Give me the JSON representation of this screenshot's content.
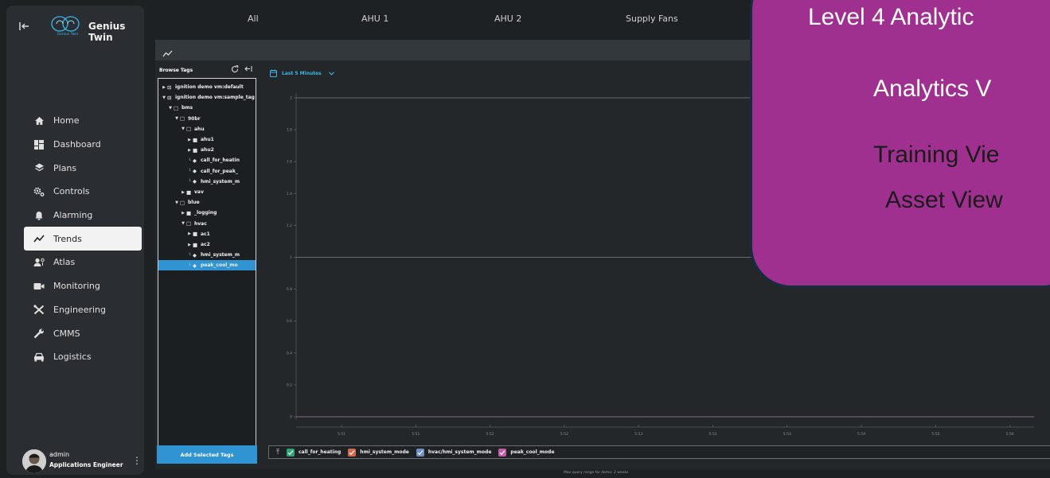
{
  "app": {
    "brand": "Genius Twin",
    "logo_caption": "Genius Twin"
  },
  "sidebar": {
    "items": [
      {
        "label": "Home",
        "icon": "home-icon",
        "active": false
      },
      {
        "label": "Dashboard",
        "icon": "dashboard-icon",
        "active": false
      },
      {
        "label": "Plans",
        "icon": "layers-icon",
        "active": false
      },
      {
        "label": "Controls",
        "icon": "gears-icon",
        "active": false
      },
      {
        "label": "Alarming",
        "icon": "bell-icon",
        "active": false
      },
      {
        "label": "Trends",
        "icon": "trend-line-icon",
        "active": true
      },
      {
        "label": "Atlas",
        "icon": "user-group-icon",
        "active": false
      },
      {
        "label": "Monitoring",
        "icon": "video-camera-icon",
        "active": false
      },
      {
        "label": "Engineering",
        "icon": "tools-icon",
        "active": false
      },
      {
        "label": "CMMS",
        "icon": "wrench-icon",
        "active": false
      },
      {
        "label": "Logistics",
        "icon": "car-icon",
        "active": false
      }
    ],
    "user": {
      "name": "admin",
      "role": "Applications Engineer"
    }
  },
  "tabs": [
    "All",
    "AHU 1",
    "AHU 2",
    "Supply Fans"
  ],
  "browse": {
    "title": "Browse Tags",
    "add_button": "Add Selected Tags",
    "tree": [
      {
        "label": "ignition demo vm:default",
        "depth": 0,
        "expanded": false,
        "type": "provider"
      },
      {
        "label": "ignition demo vm:sample_tag",
        "depth": 0,
        "expanded": true,
        "type": "provider"
      },
      {
        "label": "bms",
        "depth": 1,
        "expanded": true,
        "type": "folder"
      },
      {
        "label": "90br",
        "depth": 2,
        "expanded": true,
        "type": "folder"
      },
      {
        "label": "ahu",
        "depth": 3,
        "expanded": true,
        "type": "folder"
      },
      {
        "label": "ahu1",
        "depth": 4,
        "expanded": false,
        "type": "folder-filled"
      },
      {
        "label": "ahu2",
        "depth": 4,
        "expanded": false,
        "type": "folder-filled"
      },
      {
        "label": "call_for_heatin",
        "depth": 4,
        "type": "tag"
      },
      {
        "label": "call_for_peak_",
        "depth": 4,
        "type": "tag"
      },
      {
        "label": "hmi_system_m",
        "depth": 4,
        "type": "tag"
      },
      {
        "label": "vav",
        "depth": 3,
        "expanded": false,
        "type": "folder-filled"
      },
      {
        "label": "blue",
        "depth": 2,
        "expanded": true,
        "type": "folder"
      },
      {
        "label": "_logging",
        "depth": 3,
        "expanded": false,
        "type": "folder-filled"
      },
      {
        "label": "hvac",
        "depth": 3,
        "expanded": true,
        "type": "folder"
      },
      {
        "label": "ac1",
        "depth": 4,
        "expanded": false,
        "type": "folder-filled"
      },
      {
        "label": "ac2",
        "depth": 4,
        "expanded": false,
        "type": "folder-filled"
      },
      {
        "label": "hmi_system_m",
        "depth": 4,
        "type": "tag"
      },
      {
        "label": "peak_cool_mo",
        "depth": 4,
        "type": "tag",
        "selected": true
      }
    ]
  },
  "chart": {
    "range_label": "Last 5 Minutes",
    "footer_note": "Max query range for demo: 2 weeks"
  },
  "chart_data": {
    "type": "line",
    "title": "",
    "xlabel": "",
    "ylabel": "",
    "ylim": [
      0,
      2
    ],
    "y_ticks": [
      "0",
      "0.2",
      "0.4",
      "0.6",
      "0.8",
      "1",
      "1.2",
      "1.4",
      "1.6",
      "1.8",
      "2"
    ],
    "x_ticks": [
      "5:51",
      "5:51",
      "5:52",
      "5:52",
      "5:53",
      "5:53",
      "5:54",
      "5:54",
      "5:55",
      "5:56"
    ],
    "series": [
      {
        "name": "call_for_heating",
        "color": "#2fa578",
        "values": [
          0,
          0,
          0,
          0,
          0,
          0,
          0,
          0,
          0,
          0
        ]
      },
      {
        "name": "hmi_system_mode",
        "color": "#d9684a",
        "values": [
          2,
          2,
          2,
          2,
          2,
          2,
          2,
          2,
          2,
          2
        ]
      },
      {
        "name": "hvac/hmi_system_mode",
        "color": "#6f8fc8",
        "values": [
          1,
          1,
          1,
          1,
          1,
          1,
          1,
          1,
          1,
          1
        ]
      },
      {
        "name": "peak_cool_mode",
        "color": "#c85aa8",
        "values": [
          0,
          0,
          0,
          0,
          0,
          0,
          0,
          0,
          0,
          0
        ]
      }
    ]
  },
  "callout": {
    "lines": [
      "Level 4 Analytic",
      "Analytics V",
      "Training Vie",
      "Asset View"
    ],
    "color": "#a0308f"
  }
}
